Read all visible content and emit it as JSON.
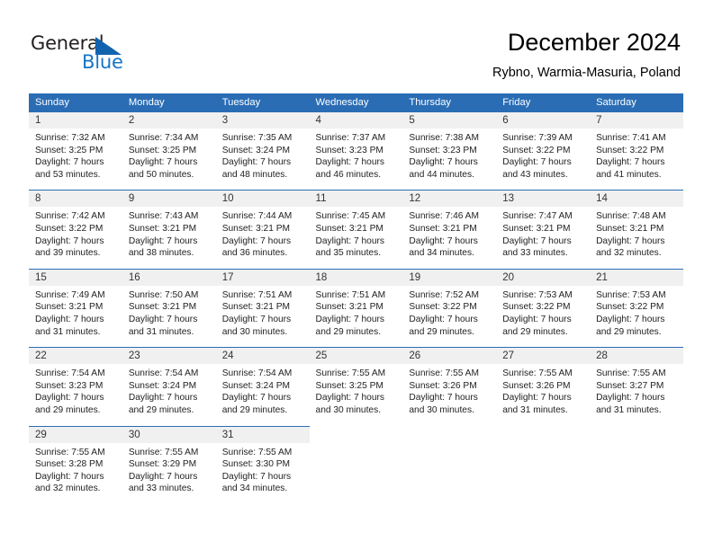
{
  "brand": {
    "name_part1": "General",
    "name_part2": "Blue",
    "triangle_color": "#1263ad",
    "blue_color": "#1675c6"
  },
  "header": {
    "title": "December 2024",
    "subtitle": "Rybno, Warmia-Masuria, Poland"
  },
  "theme": {
    "header_blue": "#2a6db5",
    "daynum_band": "#f0f0f0",
    "text": "#222222"
  },
  "weekday_headers": [
    "Sunday",
    "Monday",
    "Tuesday",
    "Wednesday",
    "Thursday",
    "Friday",
    "Saturday"
  ],
  "days": [
    {
      "date": "1",
      "sunrise": "Sunrise: 7:32 AM",
      "sunset": "Sunset: 3:25 PM",
      "daylight1": "Daylight: 7 hours",
      "daylight2": "and 53 minutes."
    },
    {
      "date": "2",
      "sunrise": "Sunrise: 7:34 AM",
      "sunset": "Sunset: 3:25 PM",
      "daylight1": "Daylight: 7 hours",
      "daylight2": "and 50 minutes."
    },
    {
      "date": "3",
      "sunrise": "Sunrise: 7:35 AM",
      "sunset": "Sunset: 3:24 PM",
      "daylight1": "Daylight: 7 hours",
      "daylight2": "and 48 minutes."
    },
    {
      "date": "4",
      "sunrise": "Sunrise: 7:37 AM",
      "sunset": "Sunset: 3:23 PM",
      "daylight1": "Daylight: 7 hours",
      "daylight2": "and 46 minutes."
    },
    {
      "date": "5",
      "sunrise": "Sunrise: 7:38 AM",
      "sunset": "Sunset: 3:23 PM",
      "daylight1": "Daylight: 7 hours",
      "daylight2": "and 44 minutes."
    },
    {
      "date": "6",
      "sunrise": "Sunrise: 7:39 AM",
      "sunset": "Sunset: 3:22 PM",
      "daylight1": "Daylight: 7 hours",
      "daylight2": "and 43 minutes."
    },
    {
      "date": "7",
      "sunrise": "Sunrise: 7:41 AM",
      "sunset": "Sunset: 3:22 PM",
      "daylight1": "Daylight: 7 hours",
      "daylight2": "and 41 minutes."
    },
    {
      "date": "8",
      "sunrise": "Sunrise: 7:42 AM",
      "sunset": "Sunset: 3:22 PM",
      "daylight1": "Daylight: 7 hours",
      "daylight2": "and 39 minutes."
    },
    {
      "date": "9",
      "sunrise": "Sunrise: 7:43 AM",
      "sunset": "Sunset: 3:21 PM",
      "daylight1": "Daylight: 7 hours",
      "daylight2": "and 38 minutes."
    },
    {
      "date": "10",
      "sunrise": "Sunrise: 7:44 AM",
      "sunset": "Sunset: 3:21 PM",
      "daylight1": "Daylight: 7 hours",
      "daylight2": "and 36 minutes."
    },
    {
      "date": "11",
      "sunrise": "Sunrise: 7:45 AM",
      "sunset": "Sunset: 3:21 PM",
      "daylight1": "Daylight: 7 hours",
      "daylight2": "and 35 minutes."
    },
    {
      "date": "12",
      "sunrise": "Sunrise: 7:46 AM",
      "sunset": "Sunset: 3:21 PM",
      "daylight1": "Daylight: 7 hours",
      "daylight2": "and 34 minutes."
    },
    {
      "date": "13",
      "sunrise": "Sunrise: 7:47 AM",
      "sunset": "Sunset: 3:21 PM",
      "daylight1": "Daylight: 7 hours",
      "daylight2": "and 33 minutes."
    },
    {
      "date": "14",
      "sunrise": "Sunrise: 7:48 AM",
      "sunset": "Sunset: 3:21 PM",
      "daylight1": "Daylight: 7 hours",
      "daylight2": "and 32 minutes."
    },
    {
      "date": "15",
      "sunrise": "Sunrise: 7:49 AM",
      "sunset": "Sunset: 3:21 PM",
      "daylight1": "Daylight: 7 hours",
      "daylight2": "and 31 minutes."
    },
    {
      "date": "16",
      "sunrise": "Sunrise: 7:50 AM",
      "sunset": "Sunset: 3:21 PM",
      "daylight1": "Daylight: 7 hours",
      "daylight2": "and 31 minutes."
    },
    {
      "date": "17",
      "sunrise": "Sunrise: 7:51 AM",
      "sunset": "Sunset: 3:21 PM",
      "daylight1": "Daylight: 7 hours",
      "daylight2": "and 30 minutes."
    },
    {
      "date": "18",
      "sunrise": "Sunrise: 7:51 AM",
      "sunset": "Sunset: 3:21 PM",
      "daylight1": "Daylight: 7 hours",
      "daylight2": "and 29 minutes."
    },
    {
      "date": "19",
      "sunrise": "Sunrise: 7:52 AM",
      "sunset": "Sunset: 3:22 PM",
      "daylight1": "Daylight: 7 hours",
      "daylight2": "and 29 minutes."
    },
    {
      "date": "20",
      "sunrise": "Sunrise: 7:53 AM",
      "sunset": "Sunset: 3:22 PM",
      "daylight1": "Daylight: 7 hours",
      "daylight2": "and 29 minutes."
    },
    {
      "date": "21",
      "sunrise": "Sunrise: 7:53 AM",
      "sunset": "Sunset: 3:22 PM",
      "daylight1": "Daylight: 7 hours",
      "daylight2": "and 29 minutes."
    },
    {
      "date": "22",
      "sunrise": "Sunrise: 7:54 AM",
      "sunset": "Sunset: 3:23 PM",
      "daylight1": "Daylight: 7 hours",
      "daylight2": "and 29 minutes."
    },
    {
      "date": "23",
      "sunrise": "Sunrise: 7:54 AM",
      "sunset": "Sunset: 3:24 PM",
      "daylight1": "Daylight: 7 hours",
      "daylight2": "and 29 minutes."
    },
    {
      "date": "24",
      "sunrise": "Sunrise: 7:54 AM",
      "sunset": "Sunset: 3:24 PM",
      "daylight1": "Daylight: 7 hours",
      "daylight2": "and 29 minutes."
    },
    {
      "date": "25",
      "sunrise": "Sunrise: 7:55 AM",
      "sunset": "Sunset: 3:25 PM",
      "daylight1": "Daylight: 7 hours",
      "daylight2": "and 30 minutes."
    },
    {
      "date": "26",
      "sunrise": "Sunrise: 7:55 AM",
      "sunset": "Sunset: 3:26 PM",
      "daylight1": "Daylight: 7 hours",
      "daylight2": "and 30 minutes."
    },
    {
      "date": "27",
      "sunrise": "Sunrise: 7:55 AM",
      "sunset": "Sunset: 3:26 PM",
      "daylight1": "Daylight: 7 hours",
      "daylight2": "and 31 minutes."
    },
    {
      "date": "28",
      "sunrise": "Sunrise: 7:55 AM",
      "sunset": "Sunset: 3:27 PM",
      "daylight1": "Daylight: 7 hours",
      "daylight2": "and 31 minutes."
    },
    {
      "date": "29",
      "sunrise": "Sunrise: 7:55 AM",
      "sunset": "Sunset: 3:28 PM",
      "daylight1": "Daylight: 7 hours",
      "daylight2": "and 32 minutes."
    },
    {
      "date": "30",
      "sunrise": "Sunrise: 7:55 AM",
      "sunset": "Sunset: 3:29 PM",
      "daylight1": "Daylight: 7 hours",
      "daylight2": "and 33 minutes."
    },
    {
      "date": "31",
      "sunrise": "Sunrise: 7:55 AM",
      "sunset": "Sunset: 3:30 PM",
      "daylight1": "Daylight: 7 hours",
      "daylight2": "and 34 minutes."
    }
  ],
  "grid": {
    "first_day_column_index": 0,
    "weeks": 5
  }
}
